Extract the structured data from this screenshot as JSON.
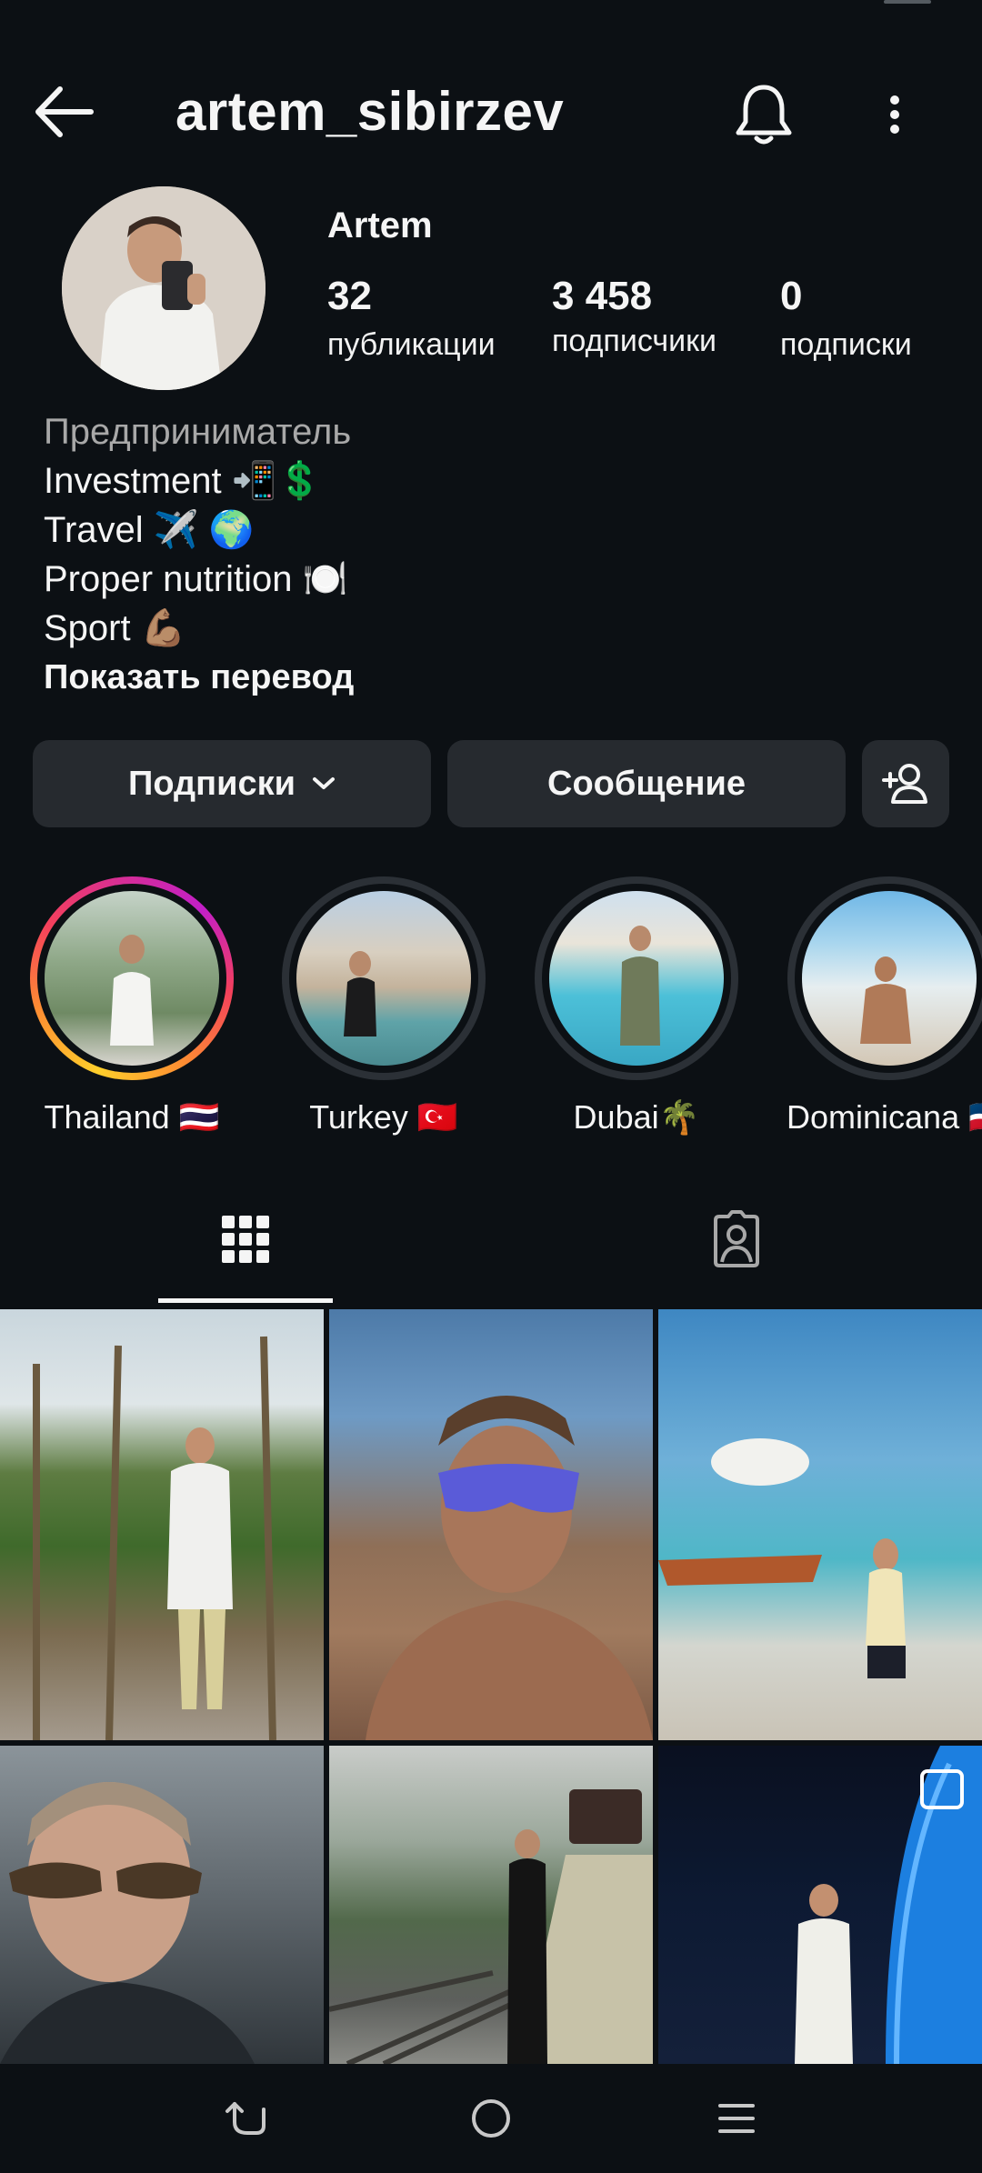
{
  "header": {
    "username": "artem_sibirzev"
  },
  "profile": {
    "display_name": "Artem",
    "stats": [
      {
        "value": "32",
        "label": "публикации"
      },
      {
        "value": "3 458",
        "label": "подписчики"
      },
      {
        "value": "0",
        "label": "подписки"
      }
    ],
    "bio": {
      "category": "Предприниматель",
      "lines": [
        "Investment 📲💲",
        "Travel ✈️ 🌍",
        "Proper nutrition 🍽️",
        "Sport 💪🏽"
      ],
      "translate_link": "Показать перевод"
    }
  },
  "actions": {
    "following_label": "Подписки",
    "message_label": "Сообщение"
  },
  "highlights": [
    {
      "label": "Thailand 🇹🇭"
    },
    {
      "label": "Turkey 🇹🇷"
    },
    {
      "label": "Dubai🌴"
    },
    {
      "label": "Dominicana 🇩🇴"
    }
  ],
  "colors": {
    "background": "#0c1014",
    "button": "#262a2f",
    "muted_text": "#a8a8a8"
  }
}
